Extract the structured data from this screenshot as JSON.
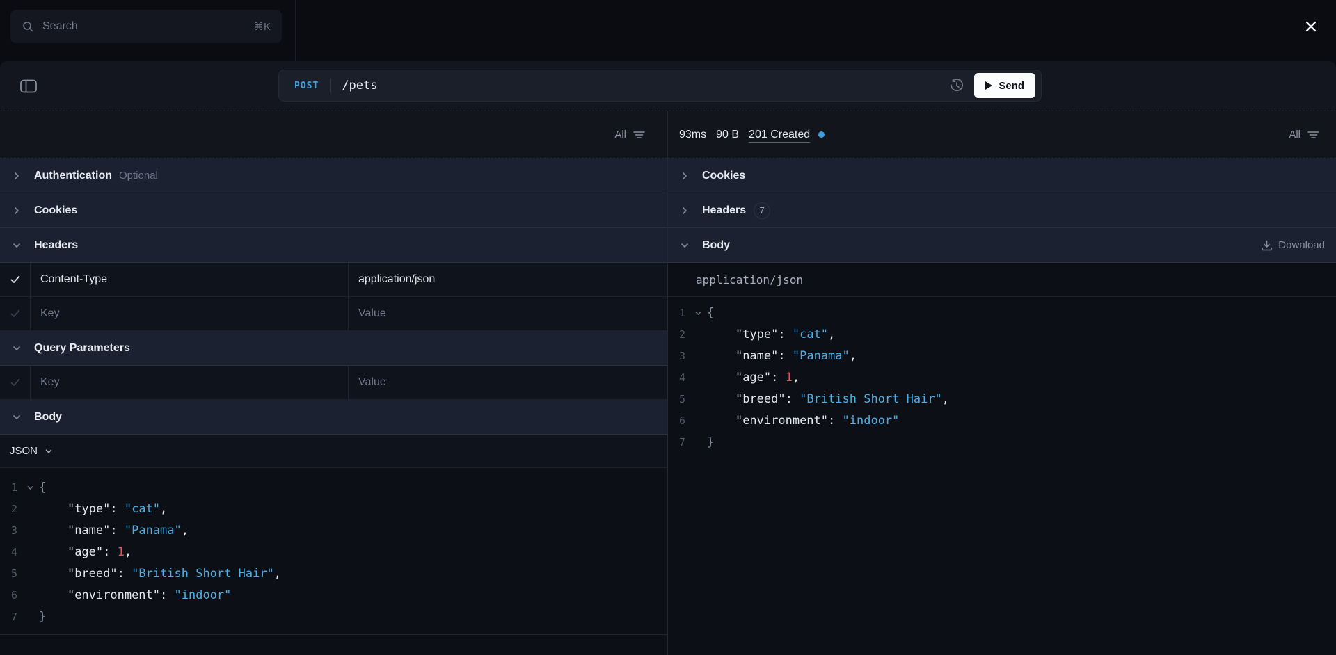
{
  "topbar": {
    "search_placeholder": "Search",
    "search_shortcut": "⌘K"
  },
  "toolbar": {
    "method": "POST",
    "path": "/pets",
    "send_label": "Send"
  },
  "request": {
    "filter_label": "All",
    "sections": {
      "authentication": {
        "label": "Authentication",
        "hint": "Optional"
      },
      "cookies": {
        "label": "Cookies"
      },
      "headers": {
        "label": "Headers"
      },
      "query_parameters": {
        "label": "Query Parameters"
      },
      "body": {
        "label": "Body"
      }
    },
    "headers_rows": [
      {
        "checked": true,
        "key": "Content-Type",
        "value": "application/json"
      },
      {
        "checked": false,
        "key_placeholder": "Key",
        "value_placeholder": "Value"
      }
    ],
    "query_rows": [
      {
        "checked": false,
        "key_placeholder": "Key",
        "value_placeholder": "Value"
      }
    ],
    "body_format": "JSON"
  },
  "response": {
    "filter_label": "All",
    "meta": {
      "duration": "93ms",
      "size": "90 B",
      "status": "201 Created"
    },
    "sections": {
      "cookies": {
        "label": "Cookies"
      },
      "headers": {
        "label": "Headers",
        "badge": "7"
      },
      "body": {
        "label": "Body",
        "action_label": "Download"
      }
    },
    "content_type": "application/json"
  },
  "code_lines": [
    {
      "num": "1",
      "fold": true,
      "segments": [
        {
          "text": "{",
          "cls": "punc"
        }
      ]
    },
    {
      "num": "2",
      "fold": false,
      "segments": [
        {
          "text": "    ",
          "cls": "plain"
        },
        {
          "text": "\"type\"",
          "cls": "key"
        },
        {
          "text": ": ",
          "cls": "plain"
        },
        {
          "text": "\"cat\"",
          "cls": "str"
        },
        {
          "text": ",",
          "cls": "plain"
        }
      ]
    },
    {
      "num": "3",
      "fold": false,
      "segments": [
        {
          "text": "    ",
          "cls": "plain"
        },
        {
          "text": "\"name\"",
          "cls": "key"
        },
        {
          "text": ": ",
          "cls": "plain"
        },
        {
          "text": "\"Panama\"",
          "cls": "str"
        },
        {
          "text": ",",
          "cls": "plain"
        }
      ]
    },
    {
      "num": "4",
      "fold": false,
      "segments": [
        {
          "text": "    ",
          "cls": "plain"
        },
        {
          "text": "\"age\"",
          "cls": "key"
        },
        {
          "text": ": ",
          "cls": "plain"
        },
        {
          "text": "1",
          "cls": "num"
        },
        {
          "text": ",",
          "cls": "plain"
        }
      ]
    },
    {
      "num": "5",
      "fold": false,
      "segments": [
        {
          "text": "    ",
          "cls": "plain"
        },
        {
          "text": "\"breed\"",
          "cls": "key"
        },
        {
          "text": ": ",
          "cls": "plain"
        },
        {
          "text": "\"British Short Hair\"",
          "cls": "str"
        },
        {
          "text": ",",
          "cls": "plain"
        }
      ]
    },
    {
      "num": "6",
      "fold": false,
      "segments": [
        {
          "text": "    ",
          "cls": "plain"
        },
        {
          "text": "\"environment\"",
          "cls": "key"
        },
        {
          "text": ": ",
          "cls": "plain"
        },
        {
          "text": "\"indoor\"",
          "cls": "str"
        }
      ]
    },
    {
      "num": "7",
      "fold": false,
      "segments": [
        {
          "text": "}",
          "cls": "punc"
        }
      ]
    }
  ],
  "colors": {
    "accent_blue": "#3fa3e3",
    "string_blue": "#47afe9",
    "number_red": "#e0555f",
    "status_dot": "#3ba0df"
  }
}
